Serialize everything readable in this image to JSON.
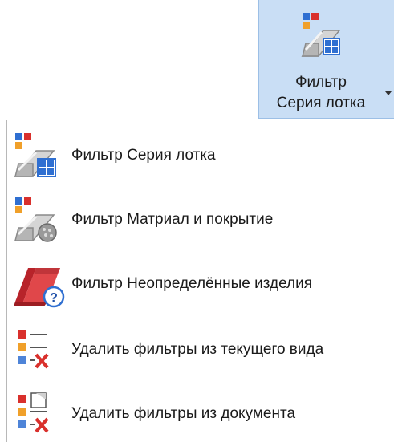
{
  "ribbon_button": {
    "line1": "Фильтр",
    "line2": "Серия лотка",
    "icon": "tray-series-filter-icon"
  },
  "menu": {
    "items": [
      {
        "label": "Фильтр  Серия лотка",
        "icon": "tray-series-filter-icon"
      },
      {
        "label": "Фильтр  Матриал и покрытие",
        "icon": "material-coating-filter-icon"
      },
      {
        "label": "Фильтр  Неопределённые изделия",
        "icon": "undefined-items-filter-icon"
      },
      {
        "label": "Удалить фильтры из текущего вида",
        "icon": "remove-filters-view-icon"
      },
      {
        "label": "Удалить фильтры из документа",
        "icon": "remove-filters-document-icon"
      }
    ]
  },
  "colors": {
    "ribbon_bg": "#c9def5",
    "ribbon_border": "#9cbfe6",
    "accent_red": "#d9302c",
    "accent_blue": "#2f6fd1",
    "accent_orange": "#f0a02a"
  }
}
